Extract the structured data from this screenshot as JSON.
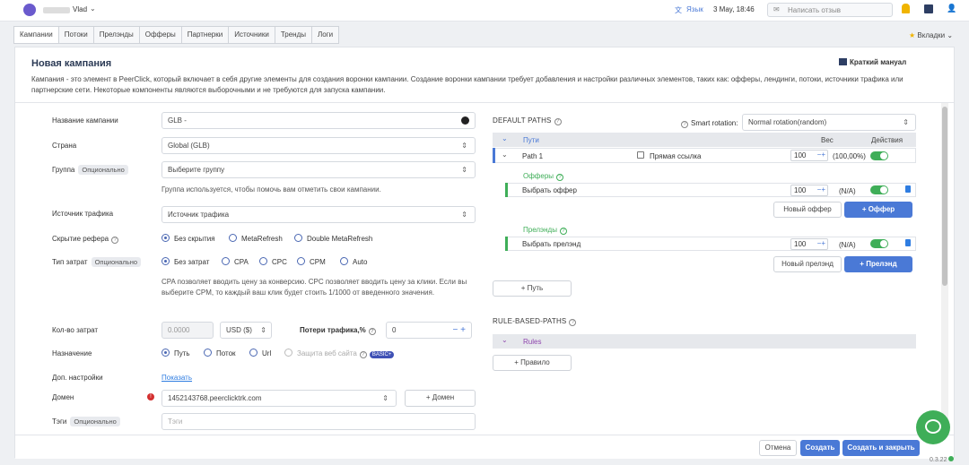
{
  "topbar": {
    "user_name": "Vlad",
    "language": "Язык",
    "datetime": "3 May, 18:46",
    "feedback": "Написать отзыв"
  },
  "tabs": [
    "Кампании",
    "Потоки",
    "Прелэнды",
    "Офферы",
    "Партнерки",
    "Источники",
    "Тренды",
    "Логи"
  ],
  "bookmarks": "Вкладки",
  "header": {
    "title": "Новая кампания",
    "manual": "Краткий мануал",
    "description": "Кампания - это элемент в PeerClick, который включает в себя другие элементы для создания воронки кампании. Создание воронки кампании требует добавления и настройки различных элементов, таких как: офферы, лендинги, потоки, источники трафика или партнерские сети. Некоторые компоненты являются выборочными и не требуются для запуска кампании."
  },
  "form": {
    "optional": "Опционально",
    "campaign_name_label": "Название кампании",
    "campaign_name_value": "GLB -",
    "country_label": "Страна",
    "country_value": "Global (GLB)",
    "group_label": "Группа",
    "group_placeholder": "Выберите группу",
    "group_help": "Группа используется, чтобы помочь вам отметить свои кампании.",
    "traffic_source_label": "Источник трафика",
    "traffic_source_value": "Источник трафика",
    "referer_label": "Скрытие рефера",
    "referer_options": [
      "Без скрытия",
      "MetaRefresh",
      "Double MetaRefresh"
    ],
    "cost_type_label": "Тип затрат",
    "cost_options": [
      "Без затрат",
      "CPA",
      "CPC",
      "CPM",
      "Auto"
    ],
    "cost_help": "CPA позволяет вводить цену за конверсию. CPC позволяет вводить цену за клики. Если вы выберите CPM, то каждый ваш клик будет стоить 1/1000 от введенного значения.",
    "cost_amount_label": "Кол-во затрат",
    "cost_amount_value": "0.0000",
    "currency": "USD ($)",
    "traffic_loss_label": "Потери трафика,%",
    "traffic_loss_value": "0",
    "destination_label": "Назначение",
    "destination_options": [
      "Путь",
      "Поток",
      "Url",
      "Защита веб сайта"
    ],
    "basic_badge": "BASIC+",
    "extra_label": "Доп. настройки",
    "extra_link": "Показать",
    "domain_label": "Домен",
    "domain_value": "1452143768.peerclicktrk.com",
    "domain_button": "+ Домен",
    "tags_label": "Тэги",
    "tags_placeholder": "Тэги"
  },
  "paths": {
    "title": "DEFAULT PATHS",
    "smart_rotation_label": "Smart rotation:",
    "smart_rotation_value": "Normal rotation(random)",
    "col_paths": "Пути",
    "col_weight": "Вес",
    "col_actions": "Действия",
    "path_name": "Path 1",
    "direct_link": "Прямая ссылка",
    "path_weight": "100",
    "path_percent": "(100,00%)",
    "offers_title": "Офферы",
    "offer_select": "Выбрать оффер",
    "offer_weight": "100",
    "offer_na": "(N/A)",
    "new_offer": "Новый оффер",
    "add_offer": "+ Оффер",
    "landers_title": "Прелэнды",
    "lander_select": "Выбрать прелэнд",
    "lander_weight": "100",
    "lander_na": "(N/A)",
    "new_lander": "Новый прелэнд",
    "add_lander": "+ Прелэнд",
    "add_path": "+ Путь",
    "rule_title": "RULE-BASED-PATHS",
    "rules": "Rules",
    "add_rule": "+ Правило"
  },
  "footer": {
    "cancel": "Отмена",
    "create": "Создать",
    "create_close": "Создать и закрыть",
    "version": "0.3.22"
  },
  "colors": {
    "accent": "#4a79d6",
    "green": "#3fae58",
    "link": "#2f7de1"
  }
}
